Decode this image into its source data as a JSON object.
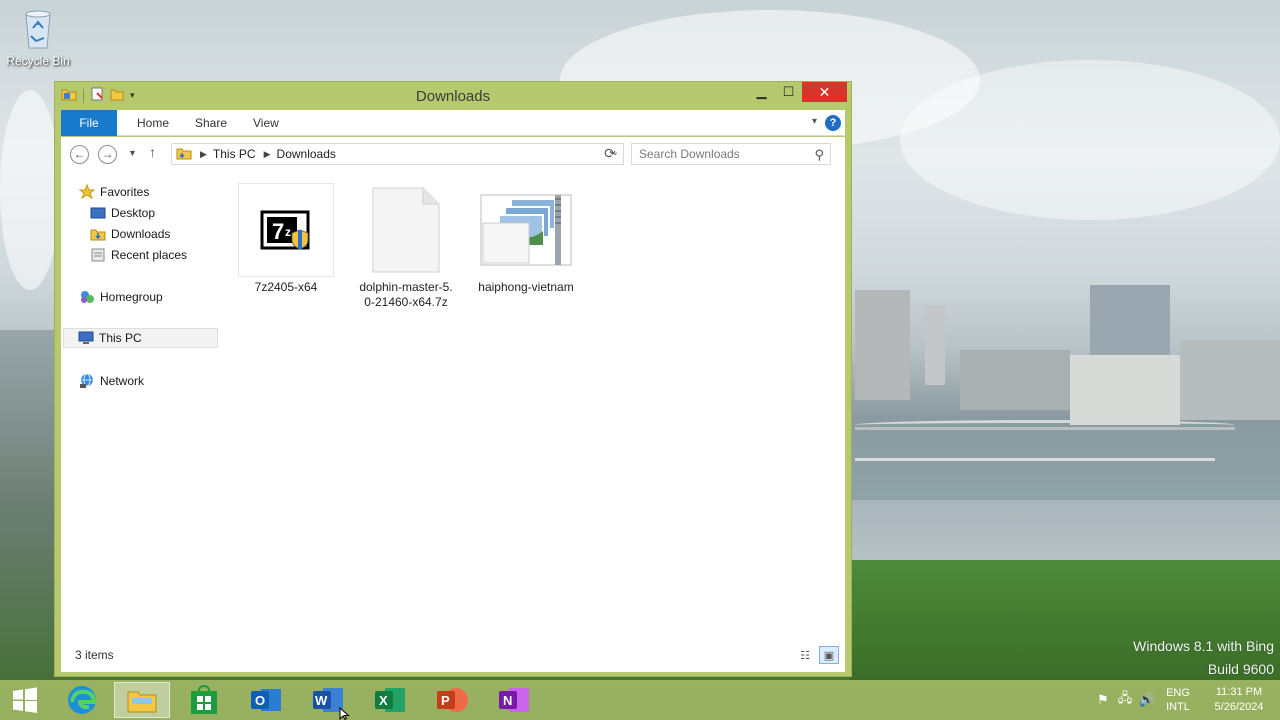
{
  "desktop": {
    "recycle_bin_label": "Recycle Bin",
    "watermark_line1": "Windows 8.1 with Bing",
    "watermark_line2": "Build 9600"
  },
  "window": {
    "title": "Downloads",
    "accent": "#b7c96f"
  },
  "ribbon": {
    "tabs": [
      "File",
      "Home",
      "Share",
      "View"
    ],
    "file_tab_color": "#1979ca",
    "help_label": "?"
  },
  "navigation": {
    "breadcrumb": [
      "This PC",
      "Downloads"
    ],
    "search_placeholder": "Search Downloads"
  },
  "sidebar": {
    "favorites": "Favorites",
    "items": [
      "Desktop",
      "Downloads",
      "Recent places"
    ],
    "homegroup": "Homegroup",
    "this_pc": "This PC",
    "network": "Network"
  },
  "files": [
    {
      "name": "7z2405-x64",
      "icon": "7zip-installer-icon"
    },
    {
      "name": "dolphin-master-5.0-21460-x64.7z",
      "icon": "blank-file-icon"
    },
    {
      "name": "haiphong-vietnam",
      "icon": "zip-folder-images-icon"
    }
  ],
  "status": {
    "item_count": "3 items"
  },
  "taskbar": {
    "apps": [
      "start",
      "edge",
      "file-explorer",
      "store",
      "outlook",
      "word",
      "excel",
      "powerpoint",
      "onenote"
    ],
    "outlook_letter": "O",
    "word_letter": "W",
    "excel_letter": "X",
    "powerpoint_letter": "P",
    "onenote_letter": "N",
    "language_line1": "ENG",
    "language_line2": "INTL",
    "time": "11:31 PM",
    "date": "5/26/2024"
  }
}
